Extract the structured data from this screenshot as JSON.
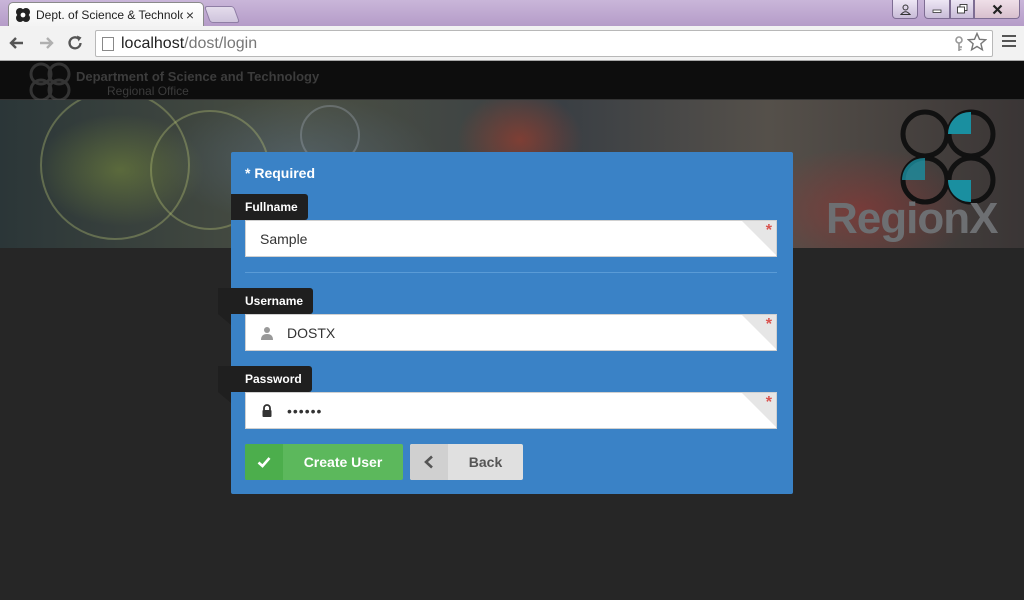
{
  "browser": {
    "tab_title": "Dept. of Science & Technology",
    "tab_close": "×",
    "url_host": "localhost",
    "url_path": "/dost/login"
  },
  "site": {
    "title": "Department of Science and Technology",
    "subtitle": "Regional Office",
    "region_text": "RegionX"
  },
  "form": {
    "required_note": "* Required",
    "fields": [
      {
        "label": "Fullname",
        "value": "Sample",
        "icon": "",
        "required_mark": "*"
      },
      {
        "label": "Username",
        "value": "DOSTX",
        "icon": "user-icon",
        "required_mark": "*"
      },
      {
        "label": "Password",
        "value": "••••••",
        "icon": "lock-icon",
        "required_mark": "*"
      }
    ],
    "buttons": {
      "create": {
        "label": "Create User",
        "icon": "check-icon",
        "color": "#5cb85c"
      },
      "back": {
        "label": "Back",
        "icon": "chevron-left-icon",
        "color": "#e0e0e0"
      }
    }
  },
  "colors": {
    "panel": "#3a82c6",
    "label_bg": "#1f1f1f",
    "required_star": "#d9534f",
    "page_bg": "#262626"
  }
}
